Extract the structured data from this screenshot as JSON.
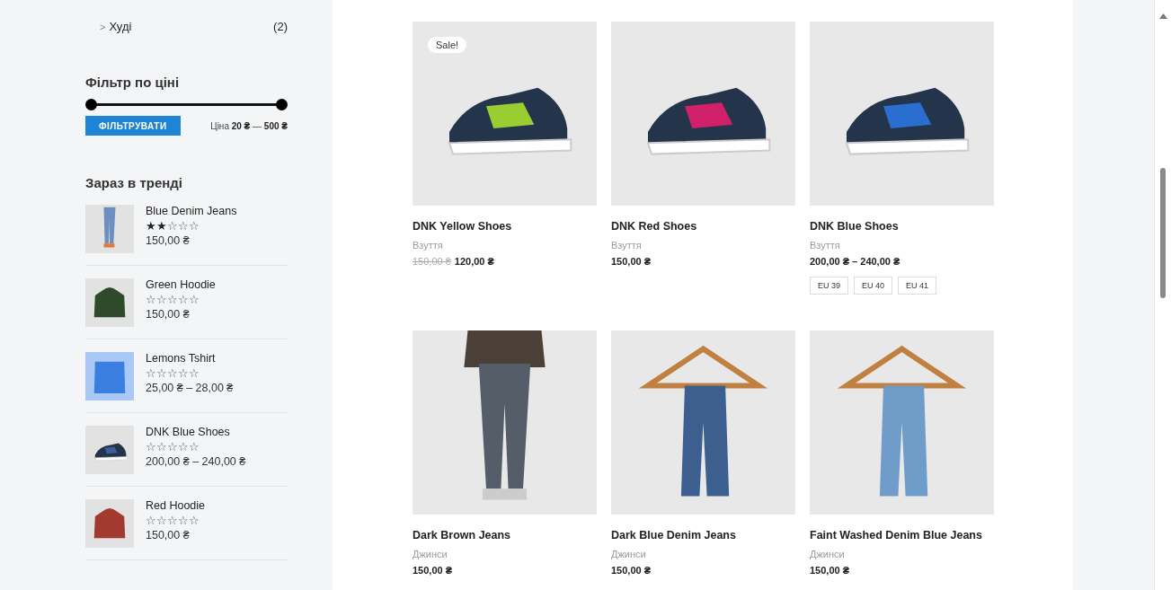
{
  "sidebar": {
    "category": {
      "icon": ">",
      "label": "Худі",
      "count": "(2)"
    },
    "price_filter": {
      "title": "Фільтр по ціні",
      "button": "ФІЛЬТРУВАТИ",
      "level": 1,
      "range_label": "Ціна",
      "min": "20 ₴",
      "separator": "—",
      "max": "500 ₴"
    },
    "trending": {
      "title": "Зараз в тренді",
      "items": [
        {
          "name": "Blue Denim Jeans",
          "stars": 2,
          "price": "150,00 ₴",
          "kind": "jeans"
        },
        {
          "name": "Green Hoodie",
          "stars": 0,
          "price": "150,00 ₴",
          "kind": "hoodie",
          "color": "#2f4a2a"
        },
        {
          "name": "Lemons Tshirt",
          "stars": 0,
          "price": "25,00 ₴ – 28,00 ₴",
          "kind": "tshirt",
          "color": "#3a7ee0"
        },
        {
          "name": "DNK Blue Shoes",
          "stars": 0,
          "price": "200,00 ₴ – 240,00 ₴",
          "kind": "shoe"
        },
        {
          "name": "Red Hoodie",
          "stars": 0,
          "price": "150,00 ₴",
          "kind": "hoodie",
          "color": "#a23a30"
        }
      ]
    }
  },
  "products": [
    {
      "name": "DNK Yellow Shoes",
      "category": "Взуття",
      "badge": "Sale!",
      "old_price": "150,00 ₴",
      "price": "120,00 ₴",
      "kind": "shoe",
      "color": "#9acd32"
    },
    {
      "name": "DNK Red Shoes",
      "category": "Взуття",
      "price": "150,00 ₴",
      "kind": "shoe",
      "color": "#d0206a"
    },
    {
      "name": "DNK Blue Shoes",
      "category": "Взуття",
      "price": "200,00 ₴ – 240,00 ₴",
      "kind": "shoe",
      "color": "#2a6fd0",
      "sizes": [
        "EU 39",
        "EU 40",
        "EU 41"
      ]
    },
    {
      "name": "Dark Brown Jeans",
      "category": "Джинси",
      "price": "150,00 ₴",
      "kind": "person"
    },
    {
      "name": "Dark Blue Denim Jeans",
      "category": "Джинси",
      "price": "150,00 ₴",
      "kind": "hanger",
      "color": "#3d5f8f"
    },
    {
      "name": "Faint Washed Denim Blue Jeans",
      "category": "Джинси",
      "price": "150,00 ₴",
      "kind": "hanger",
      "color": "#6f9cc8"
    }
  ]
}
